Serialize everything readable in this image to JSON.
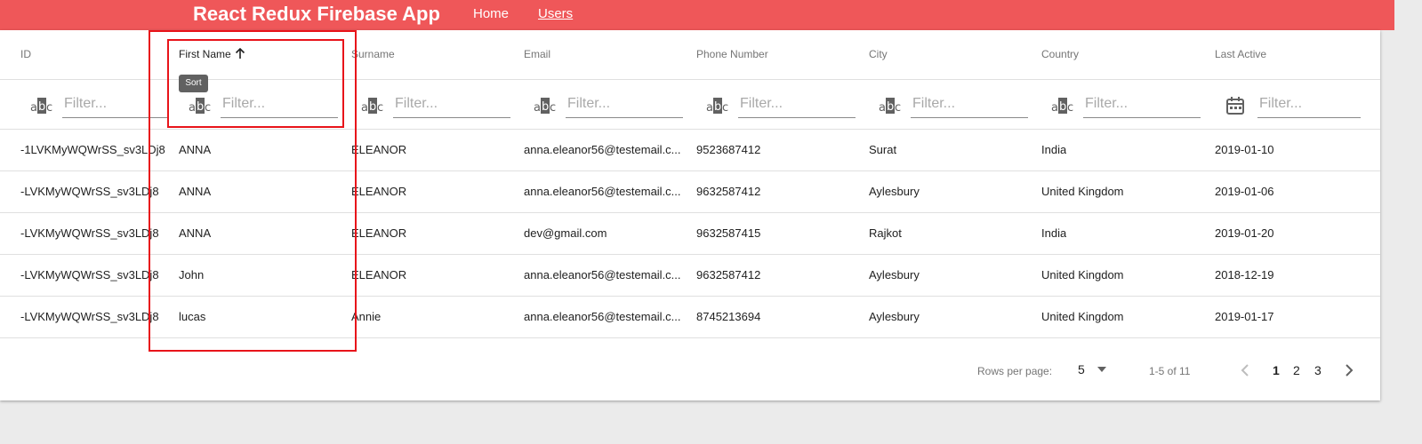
{
  "app": {
    "brand": "React Redux Firebase App",
    "nav": [
      {
        "label": "Home",
        "active": false
      },
      {
        "label": "Users",
        "active": true
      }
    ],
    "accent_color": "#ef5759",
    "highlight_color": "#e8141a"
  },
  "table": {
    "columns": [
      "ID",
      "First Name",
      "Surname",
      "Email",
      "Phone Number",
      "City",
      "Country",
      "Last Active"
    ],
    "sorted_column": "First Name",
    "sort_direction": "ascending",
    "sort_icon": "arrow-up-icon",
    "filter_placeholder": "Filter...",
    "filter_icons": [
      "abc-icon",
      "abc-icon",
      "abc-icon",
      "abc-icon",
      "abc-icon",
      "abc-icon",
      "abc-icon",
      "calendar-icon"
    ],
    "tooltip": "Sort",
    "rows": [
      {
        "id": "-1LVKMyWQWrSS_sv3LDj8",
        "first_name": "ANNA",
        "surname": "ELEANOR",
        "email": "anna.eleanor56@testemail.c...",
        "phone": "9523687412",
        "city": "Surat",
        "country": "India",
        "last_active": "2019-01-10"
      },
      {
        "id": "-LVKMyWQWrSS_sv3LDj8",
        "first_name": "ANNA",
        "surname": "ELEANOR",
        "email": "anna.eleanor56@testemail.c...",
        "phone": "9632587412",
        "city": "Aylesbury",
        "country": "United Kingdom",
        "last_active": "2019-01-06"
      },
      {
        "id": "-LVKMyWQWrSS_sv3LDj8",
        "first_name": "ANNA",
        "surname": "ELEANOR",
        "email": "dev@gmail.com",
        "phone": "9632587415",
        "city": "Rajkot",
        "country": "India",
        "last_active": "2019-01-20"
      },
      {
        "id": "-LVKMyWQWrSS_sv3LDj8",
        "first_name": "John",
        "surname": "ELEANOR",
        "email": "anna.eleanor56@testemail.c...",
        "phone": "9632587412",
        "city": "Aylesbury",
        "country": "United Kingdom",
        "last_active": "2018-12-19"
      },
      {
        "id": "-LVKMyWQWrSS_sv3LDj8",
        "first_name": "lucas",
        "surname": "Annie",
        "email": "anna.eleanor56@testemail.c...",
        "phone": "8745213694",
        "city": "Aylesbury",
        "country": "United Kingdom",
        "last_active": "2019-01-17"
      }
    ]
  },
  "pagination": {
    "rows_per_page_label": "Rows per page:",
    "rows_per_page_value": "5",
    "range_text": "1-5 of 11",
    "pages": [
      "1",
      "2",
      "3"
    ],
    "current_page": "1"
  }
}
